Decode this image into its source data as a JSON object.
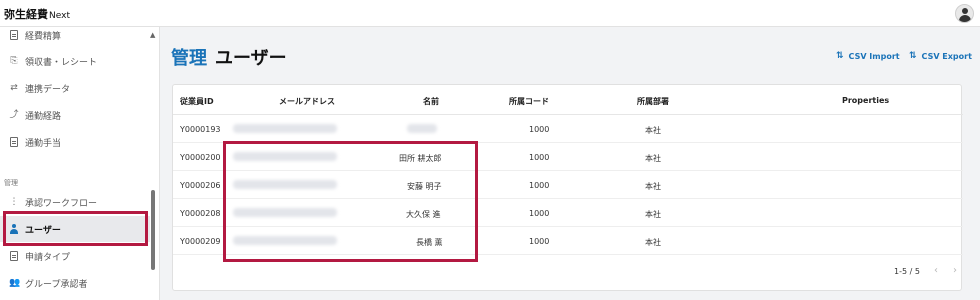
{
  "app": {
    "title_main": "弥生経費",
    "title_sub": "Next"
  },
  "sidebar": {
    "items": [
      {
        "label": "経費精算",
        "icon": "doc-icon"
      },
      {
        "label": "領収書・レシート",
        "icon": "receipt-icon"
      },
      {
        "label": "連携データ",
        "icon": "link-icon"
      },
      {
        "label": "通勤経路",
        "icon": "route-icon"
      },
      {
        "label": "通勤手当",
        "icon": "allowance-icon"
      }
    ],
    "section_label": "管理",
    "admin_items": [
      {
        "label": "承認ワークフロー",
        "icon": "workflow-icon"
      },
      {
        "label": "ユーザー",
        "icon": "user-icon"
      },
      {
        "label": "申請タイプ",
        "icon": "doc-icon"
      },
      {
        "label": "グループ承認者",
        "icon": "group-icon"
      }
    ]
  },
  "header": {
    "title_prefix": "管理",
    "title": "ユーザー",
    "csv_import": "CSV Import",
    "csv_export": "CSV Export"
  },
  "table": {
    "columns": [
      "従業員ID",
      "メールアドレス",
      "名前",
      "所属コード",
      "所属部署",
      "Properties"
    ],
    "rows": [
      {
        "id": "Y0000193",
        "name": "",
        "code": "1000",
        "dept": "本社"
      },
      {
        "id": "Y0000200",
        "name": "田所 耕太郎",
        "code": "1000",
        "dept": "本社"
      },
      {
        "id": "Y0000206",
        "name": "安藤 明子",
        "code": "1000",
        "dept": "本社"
      },
      {
        "id": "Y0000208",
        "name": "大久保 進",
        "code": "1000",
        "dept": "本社"
      },
      {
        "id": "Y0000209",
        "name": "長橋 薫",
        "code": "1000",
        "dept": "本社"
      }
    ]
  },
  "pagination": {
    "range": "1-5 / 5",
    "prev": "‹",
    "next": "›"
  },
  "colors": {
    "accent": "#1a73b8",
    "highlight": "#b31941"
  }
}
